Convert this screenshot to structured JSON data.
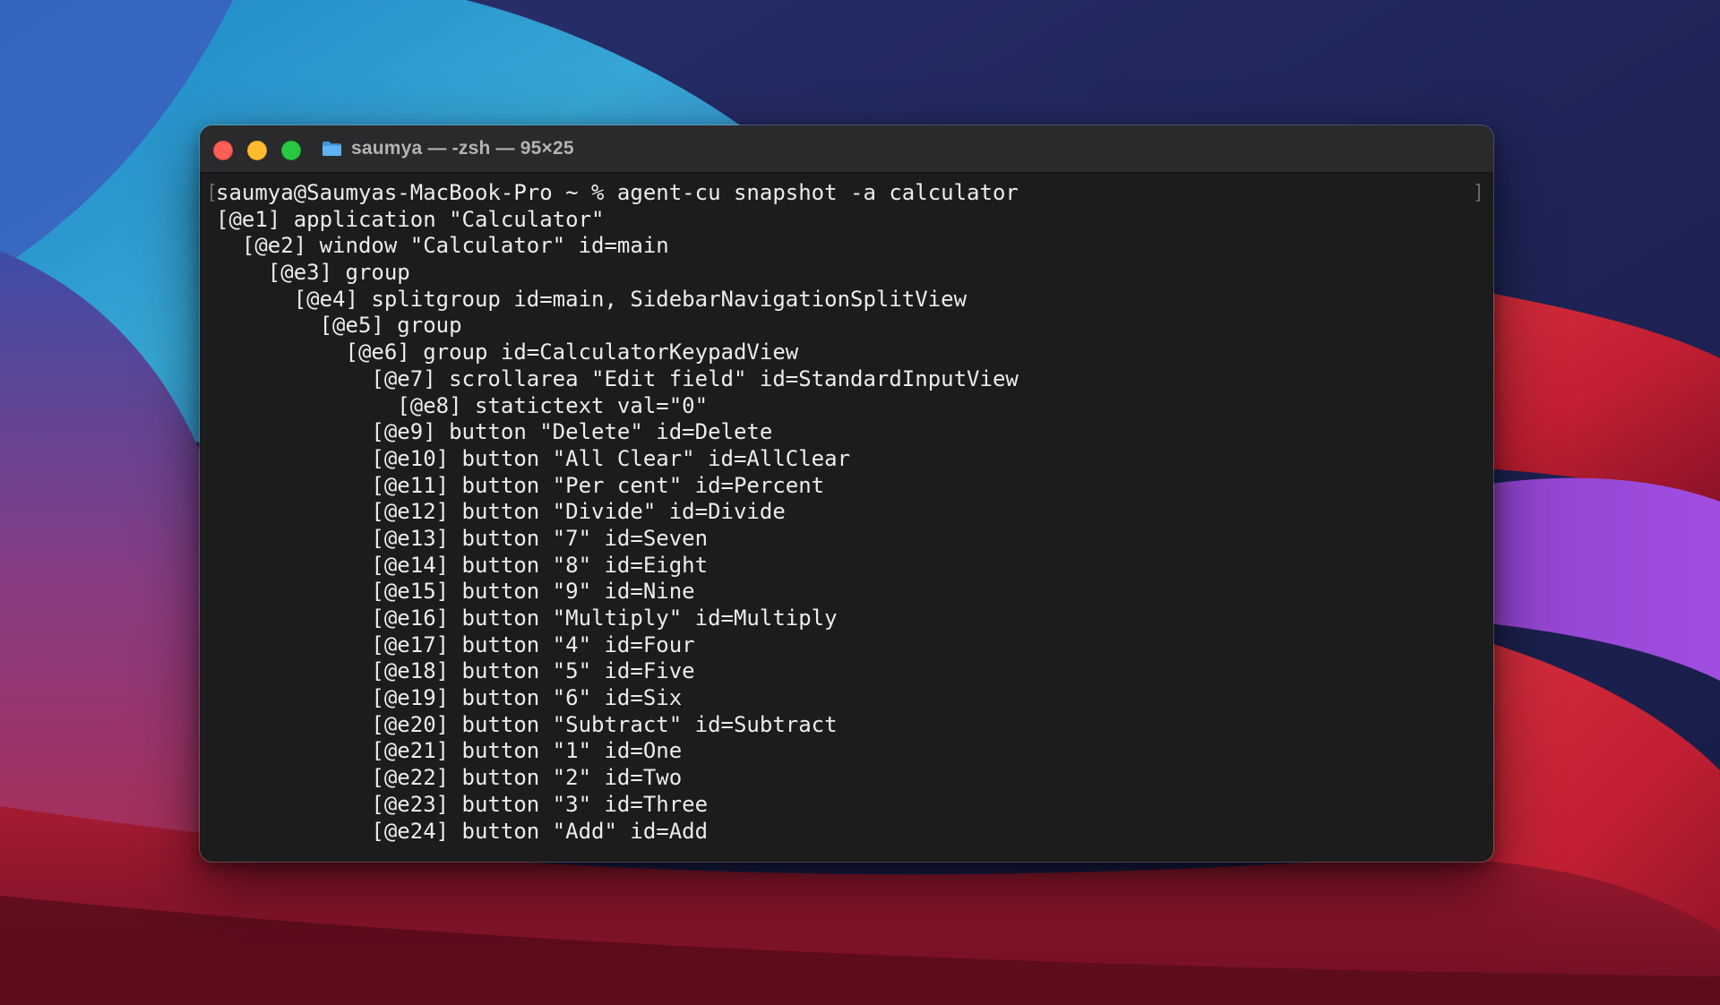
{
  "window": {
    "title": "saumya — -zsh — 95×25"
  },
  "terminal": {
    "scroll_mark_left": "[",
    "scroll_mark_right": "]",
    "lines": [
      "saumya@Saumyas-MacBook-Pro ~ % agent-cu snapshot -a calculator",
      "[@e1] application \"Calculator\"",
      "  [@e2] window \"Calculator\" id=main",
      "    [@e3] group",
      "      [@e4] splitgroup id=main, SidebarNavigationSplitView",
      "        [@e5] group",
      "          [@e6] group id=CalculatorKeypadView",
      "            [@e7] scrollarea \"Edit field\" id=StandardInputView",
      "              [@e8] statictext val=\"0\"",
      "            [@e9] button \"Delete\" id=Delete",
      "            [@e10] button \"All Clear\" id=AllClear",
      "            [@e11] button \"Per cent\" id=Percent",
      "            [@e12] button \"Divide\" id=Divide",
      "            [@e13] button \"7\" id=Seven",
      "            [@e14] button \"8\" id=Eight",
      "            [@e15] button \"9\" id=Nine",
      "            [@e16] button \"Multiply\" id=Multiply",
      "            [@e17] button \"4\" id=Four",
      "            [@e18] button \"5\" id=Five",
      "            [@e19] button \"6\" id=Six",
      "            [@e20] button \"Subtract\" id=Subtract",
      "            [@e21] button \"1\" id=One",
      "            [@e22] button \"2\" id=Two",
      "            [@e23] button \"3\" id=Three",
      "            [@e24] button \"Add\" id=Add"
    ]
  },
  "icons": {
    "close": "close-button",
    "minimize": "minimize-button",
    "zoom": "zoom-button",
    "folder": "folder-icon"
  },
  "colors": {
    "terminal_bg": "#1c1c1d",
    "titlebar_bg": "#2a2a2c",
    "text": "#ececec",
    "title_text": "#b3b3b3",
    "close": "#fe5f57",
    "minimize": "#febc2e",
    "zoom": "#28c840",
    "folder": "#4aa3e6"
  }
}
